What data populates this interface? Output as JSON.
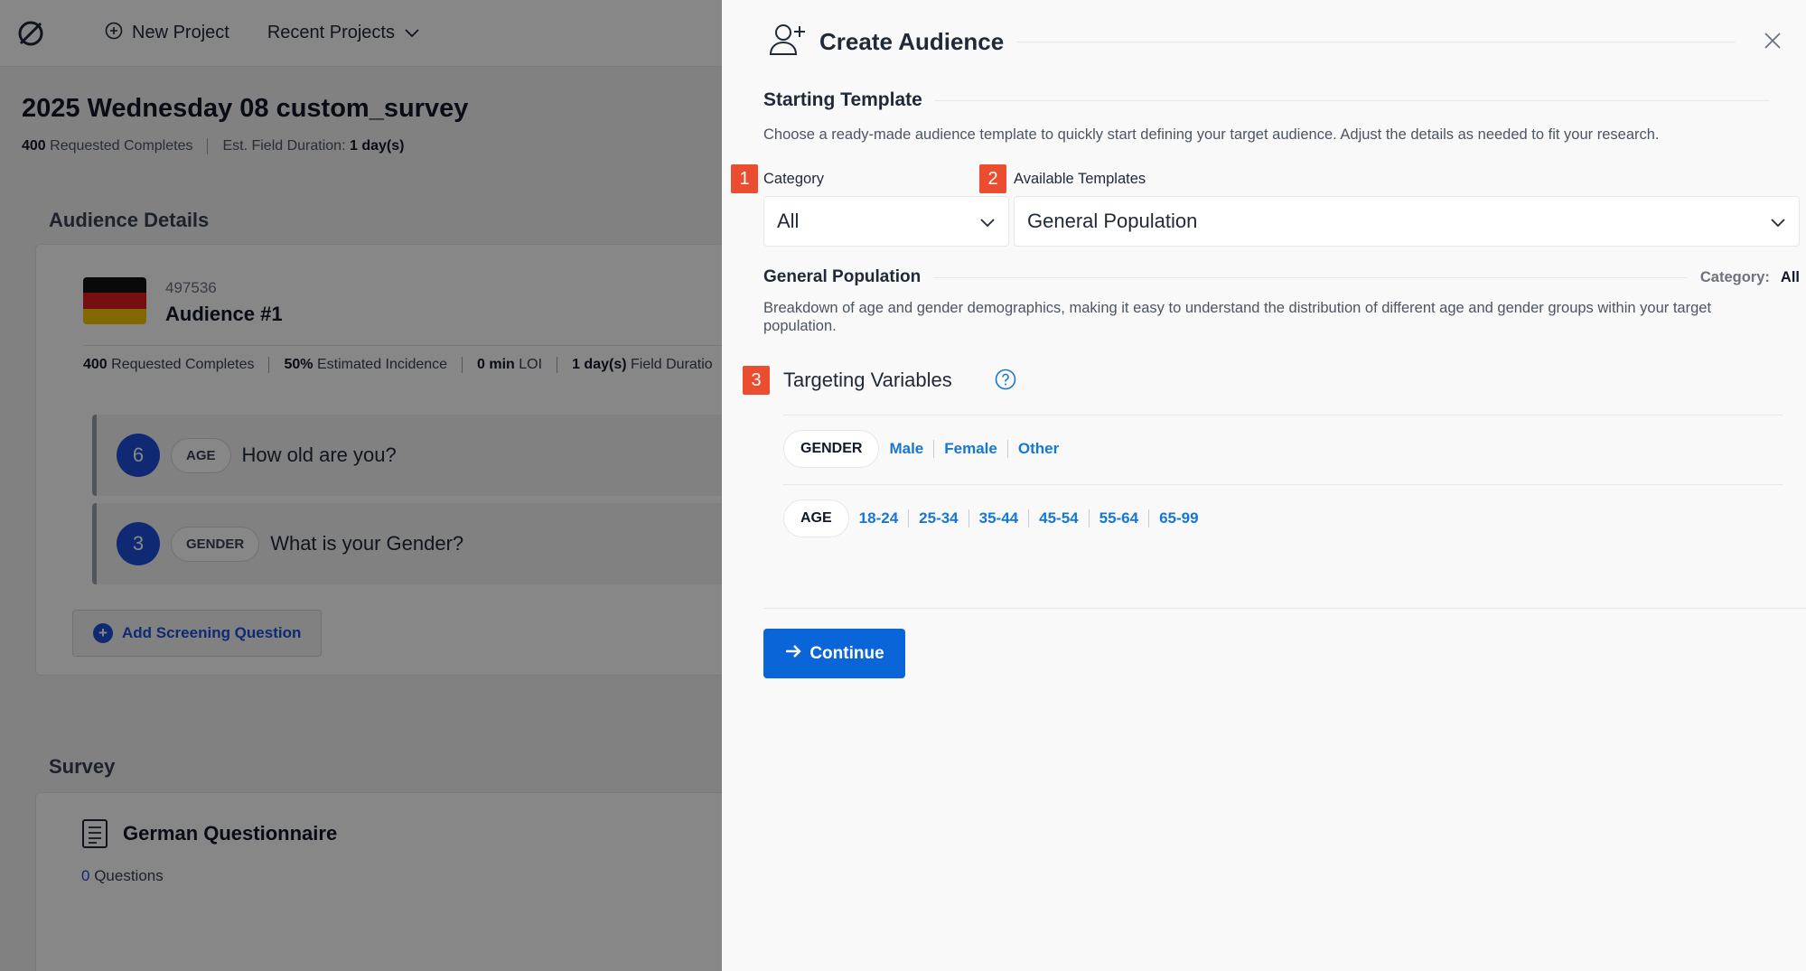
{
  "topbar": {
    "new_project": "New Project",
    "recent_projects": "Recent Projects"
  },
  "project": {
    "title": "2025 Wednesday 08 custom_survey",
    "requested_value": "400",
    "requested_label": "Requested Completes",
    "field_label": "Est. Field Duration:",
    "field_value": "1 day(s)"
  },
  "audience": {
    "section_title": "Audience Details",
    "id": "497536",
    "name": "Audience #1",
    "meta": {
      "requested_value": "400",
      "requested_label": "Requested Completes",
      "incidence_value": "50%",
      "incidence_label": "Estimated Incidence",
      "loi_value": "0 min",
      "loi_label": "LOI",
      "field_value": "1 day(s)",
      "field_label": "Field Duratio"
    },
    "questions": [
      {
        "number": "6",
        "tag": "AGE",
        "text": "How old are you?"
      },
      {
        "number": "3",
        "tag": "GENDER",
        "text": "What is your Gender?"
      }
    ],
    "add_question": "Add Screening Question"
  },
  "survey": {
    "section_title": "Survey",
    "name": "German Questionnaire",
    "count": "0",
    "count_label": "Questions"
  },
  "drawer": {
    "title": "Create Audience",
    "starting_template": {
      "title": "Starting Template",
      "description": "Choose a ready-made audience template to quickly start defining your target audience. Adjust the details as needed to fit your research."
    },
    "category": {
      "badge": "1",
      "label": "Category",
      "value": "All"
    },
    "templates": {
      "badge": "2",
      "label": "Available Templates",
      "value": "General Population"
    },
    "template_detail": {
      "title": "General Population",
      "category_label": "Category:",
      "category_value": "All",
      "description": "Breakdown of age and gender demographics, making it easy to understand the distribution of different age and gender groups within your target population."
    },
    "targeting": {
      "badge": "3",
      "title": "Targeting Variables",
      "variables": [
        {
          "tag": "GENDER",
          "options": [
            "Male",
            "Female",
            "Other"
          ]
        },
        {
          "tag": "AGE",
          "options": [
            "18-24",
            "25-34",
            "35-44",
            "45-54",
            "55-64",
            "65-99"
          ]
        }
      ]
    },
    "continue_label": "Continue"
  },
  "colors": {
    "badge": "#ea4d2f",
    "primary_button": "#0a66d8",
    "option_link": "#1677d2",
    "question_number": "#1d4ed8"
  },
  "icons": [
    "logo-icon",
    "plus-circle-icon",
    "chevron-down-icon",
    "flag-germany-icon",
    "document-icon",
    "add-user-icon",
    "close-icon",
    "help-icon",
    "arrow-right-icon"
  ]
}
